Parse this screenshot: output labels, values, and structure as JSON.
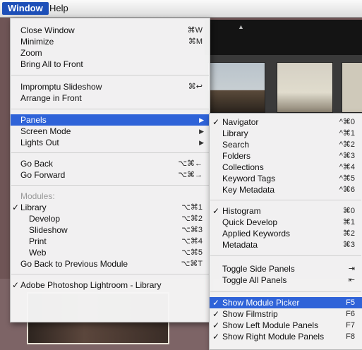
{
  "menubar": {
    "window": "Window",
    "help": "Help"
  },
  "window_menu": {
    "group1": [
      {
        "label": "Close Window",
        "shortcut": "⌘W"
      },
      {
        "label": "Minimize",
        "shortcut": "⌘M"
      },
      {
        "label": "Zoom",
        "shortcut": ""
      },
      {
        "label": "Bring All to Front",
        "shortcut": ""
      }
    ],
    "group2": [
      {
        "label": "Impromptu Slideshow",
        "shortcut": "⌘↩"
      },
      {
        "label": "Arrange in Front",
        "shortcut": ""
      }
    ],
    "group3": [
      {
        "label": "Panels",
        "submenu": true,
        "selected": true
      },
      {
        "label": "Screen Mode",
        "submenu": true
      },
      {
        "label": "Lights Out",
        "submenu": true
      }
    ],
    "group4": [
      {
        "label": "Go Back",
        "shortcut": "⌥⌘←"
      },
      {
        "label": "Go Forward",
        "shortcut": "⌥⌘→"
      }
    ],
    "modules_header": "Modules:",
    "modules": [
      {
        "label": "Library",
        "shortcut": "⌥⌘1",
        "checked": true
      },
      {
        "label": "Develop",
        "shortcut": "⌥⌘2"
      },
      {
        "label": "Slideshow",
        "shortcut": "⌥⌘3"
      },
      {
        "label": "Print",
        "shortcut": "⌥⌘4"
      },
      {
        "label": "Web",
        "shortcut": "⌥⌘5"
      }
    ],
    "go_back_module": {
      "label": "Go Back to Previous Module",
      "shortcut": "⌥⌘T"
    },
    "app_window": {
      "label": "Adobe Photoshop Lightroom - Library",
      "checked": true
    }
  },
  "panels_submenu": {
    "group1": [
      {
        "label": "Navigator",
        "shortcut": "^⌘0",
        "checked": true
      },
      {
        "label": "Library",
        "shortcut": "^⌘1"
      },
      {
        "label": "Search",
        "shortcut": "^⌘2"
      },
      {
        "label": "Folders",
        "shortcut": "^⌘3"
      },
      {
        "label": "Collections",
        "shortcut": "^⌘4"
      },
      {
        "label": "Keyword Tags",
        "shortcut": "^⌘5"
      },
      {
        "label": "Key Metadata",
        "shortcut": "^⌘6"
      }
    ],
    "group2": [
      {
        "label": "Histogram",
        "shortcut": "⌘0",
        "checked": true
      },
      {
        "label": "Quick Develop",
        "shortcut": "⌘1"
      },
      {
        "label": "Applied Keywords",
        "shortcut": "⌘2"
      },
      {
        "label": "Metadata",
        "shortcut": "⌘3"
      }
    ],
    "group3": [
      {
        "label": "Toggle Side Panels",
        "shortcut": "⇥"
      },
      {
        "label": "Toggle All Panels",
        "shortcut": "⇤"
      }
    ],
    "group4": [
      {
        "label": "Show Module Picker",
        "shortcut": "F5",
        "checked": true,
        "selected": true
      },
      {
        "label": "Show Filmstrip",
        "shortcut": "F6",
        "checked": true
      },
      {
        "label": "Show Left Module Panels",
        "shortcut": "F7",
        "checked": true
      },
      {
        "label": "Show Right Module Panels",
        "shortcut": "F8",
        "checked": true
      }
    ]
  },
  "glyphs": {
    "check": "✓",
    "submenu_arrow": "▶",
    "up_arrow": "▲"
  },
  "colors": {
    "highlight": "#2f63d8",
    "menubar_active": "#1d4fb8"
  }
}
